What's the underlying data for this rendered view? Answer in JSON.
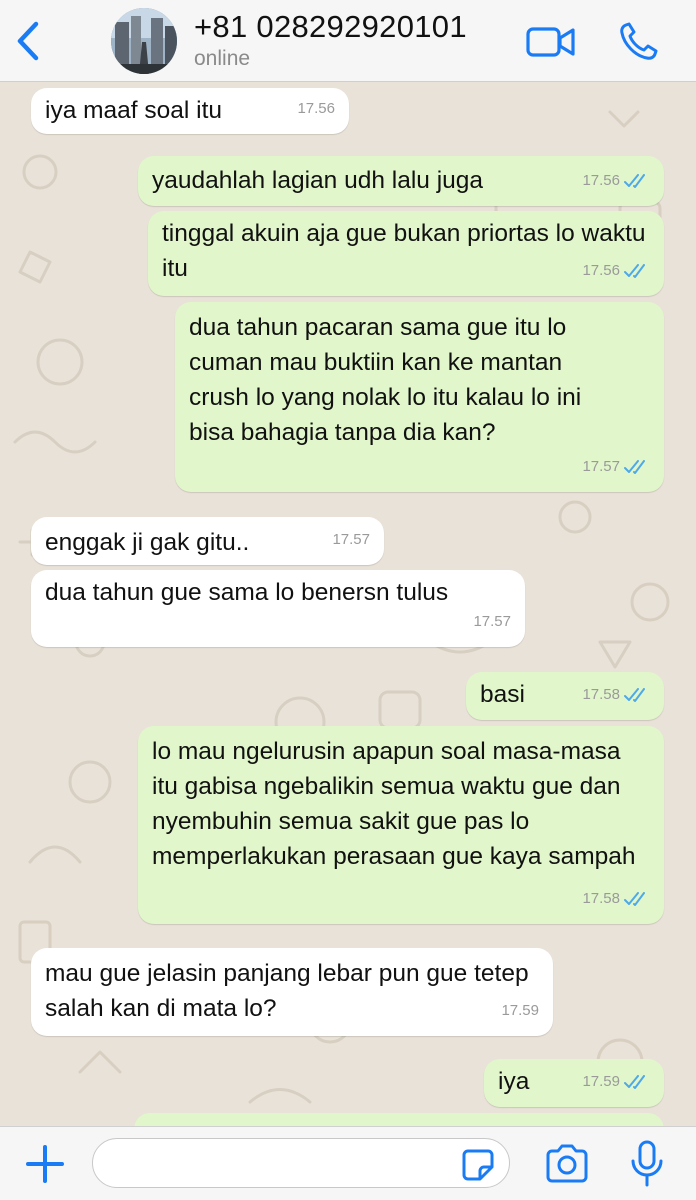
{
  "header": {
    "contact_name": "+81 028292920101",
    "status": "online"
  },
  "messages": [
    {
      "direction": "in",
      "text": "iya maaf soal itu",
      "time": "17.56"
    },
    {
      "direction": "out",
      "text": "yaudahlah lagian udh lalu juga",
      "time": "17.56",
      "read": true
    },
    {
      "direction": "out",
      "text": "tinggal akuin aja gue bukan priortas lo waktu itu",
      "time": "17.56",
      "read": true
    },
    {
      "direction": "out",
      "text": "dua tahun pacaran sama gue itu lo cuman mau buktiin kan ke mantan crush lo yang nolak lo itu kalau lo ini bisa bahagia tanpa dia kan?",
      "time": "17.57",
      "read": true
    },
    {
      "direction": "in",
      "text": "enggak ji gak gitu..",
      "time": "17.57"
    },
    {
      "direction": "in",
      "text": "dua tahun gue sama lo benersn tulus",
      "time": "17.57"
    },
    {
      "direction": "out",
      "text": "basi",
      "time": "17.58",
      "read": true
    },
    {
      "direction": "out",
      "text": "lo mau ngelurusin apapun soal masa-masa itu gabisa ngebalikin semua waktu gue dan nyembuhin semua sakit gue pas lo memperlakukan perasaan gue kaya sampah",
      "time": "17.58",
      "read": true
    },
    {
      "direction": "in",
      "text": "mau gue jelasin panjang lebar pun gue tetep salah kan di mata lo?",
      "time": "17.59"
    },
    {
      "direction": "out",
      "text": "iya",
      "time": "17.59",
      "read": true
    }
  ],
  "input": {
    "value": "",
    "placeholder": ""
  },
  "icons": {
    "back": "chevron-left-icon",
    "video": "video-camera-icon",
    "call": "phone-icon",
    "plus": "plus-icon",
    "sticker": "sticker-icon",
    "camera": "camera-icon",
    "mic": "microphone-icon"
  },
  "colors": {
    "accent": "#1a7cf5",
    "incoming_bubble": "#ffffff",
    "outgoing_bubble": "#e1f7cb",
    "read_ticks": "#4fa9e8",
    "chat_background": "#e9e2d8"
  }
}
